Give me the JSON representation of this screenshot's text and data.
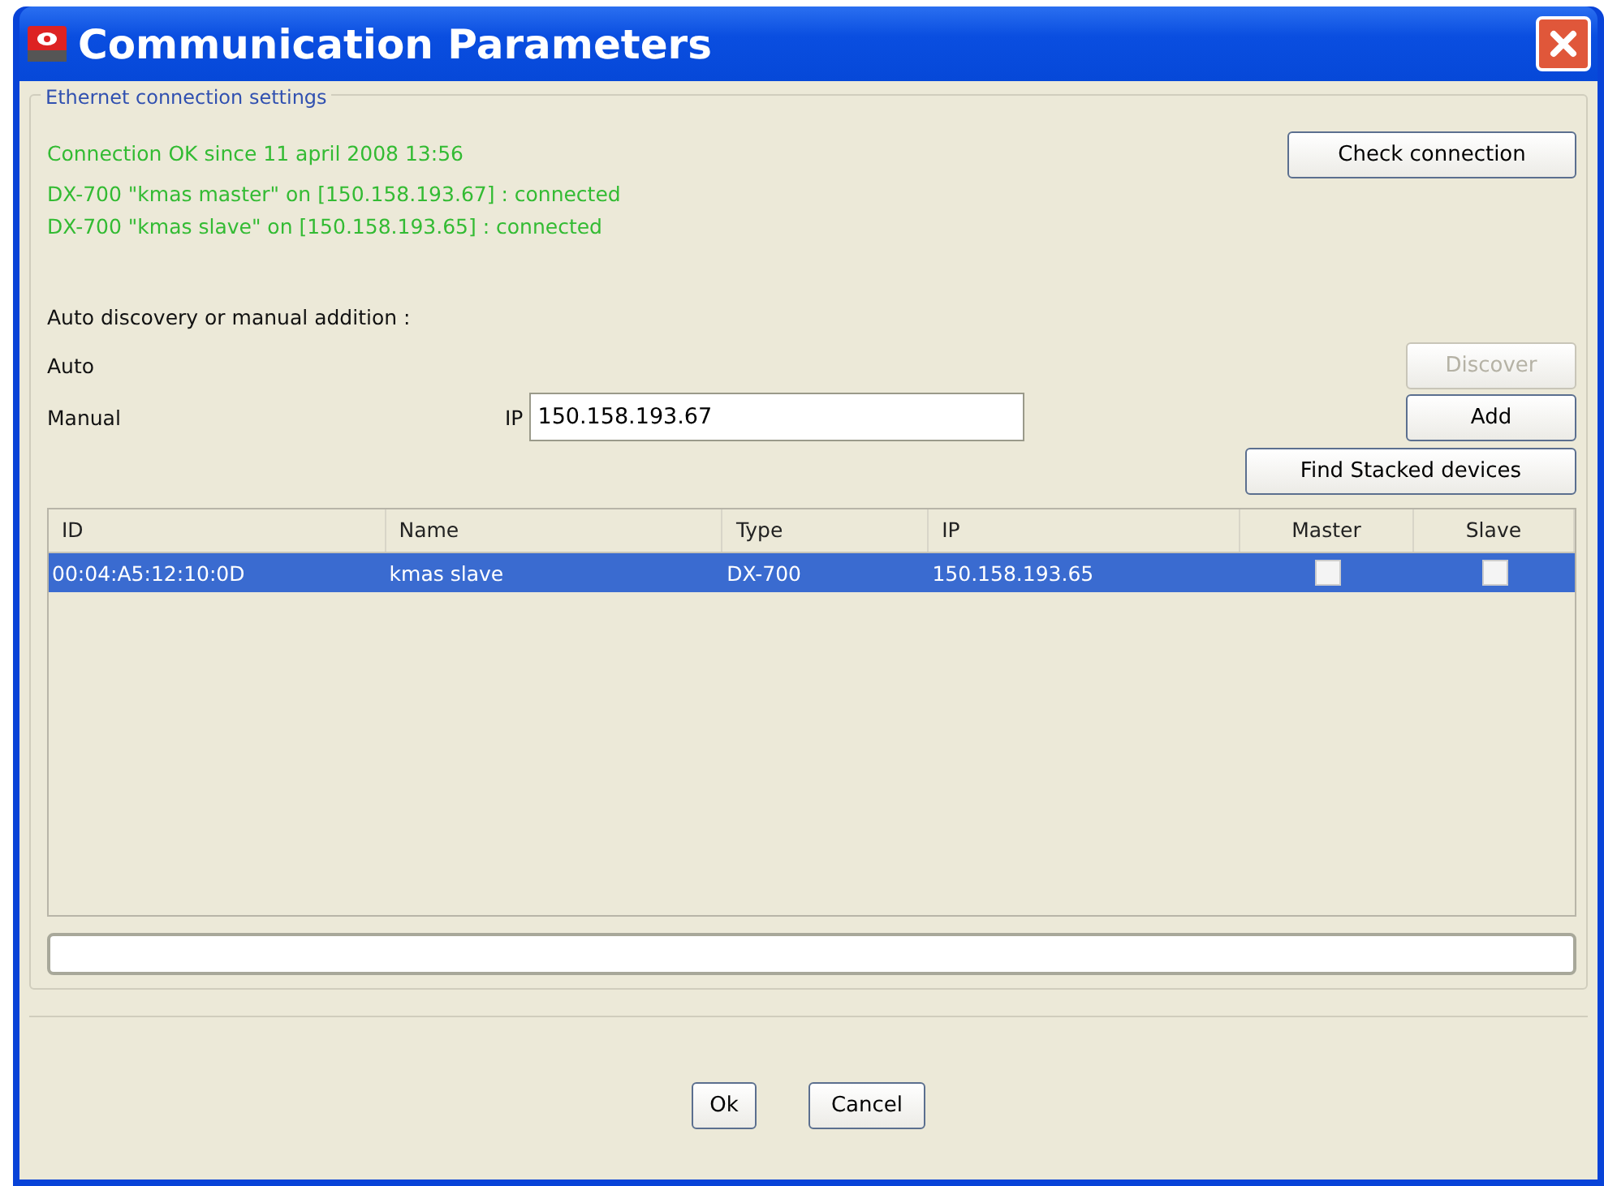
{
  "window": {
    "title": "Communication Parameters"
  },
  "group": {
    "title": "Ethernet connection settings"
  },
  "status_lines": [
    "Connection OK since 11 april 2008 13:56",
    "DX-700 \"kmas master\" on [150.158.193.67] : connected",
    "DX-700 \"kmas slave\" on [150.158.193.65] : connected"
  ],
  "check_button": {
    "label": "Check connection"
  },
  "discovery_label": "Auto discovery or manual addition :",
  "auto": {
    "label": "Auto",
    "button": {
      "label": "Discover",
      "disabled": true
    }
  },
  "manual": {
    "label": "Manual",
    "ip_label": "IP",
    "ip_value": "150.158.193.67",
    "button": {
      "label": "Add",
      "disabled": false
    }
  },
  "find_button": {
    "label": "Find Stacked devices"
  },
  "table": {
    "columns": [
      "ID",
      "Name",
      "Type",
      "IP",
      "Master",
      "Slave"
    ],
    "rows": [
      {
        "id": "00:04:A5:12:10:0D",
        "name": "kmas slave",
        "type": "DX-700",
        "ip": "150.158.193.65",
        "master": false,
        "slave": false,
        "selected": true
      }
    ]
  },
  "buttons": [
    "Ok",
    "Cancel"
  ]
}
